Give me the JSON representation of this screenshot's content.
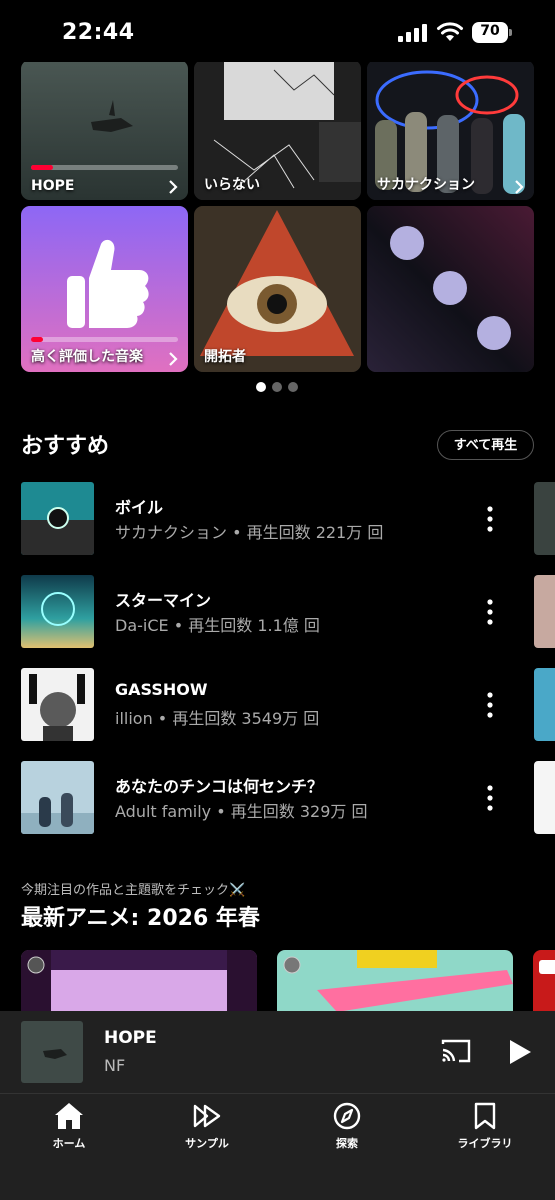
{
  "status_bar": {
    "time": "22:44",
    "battery": "70"
  },
  "tiles": [
    {
      "label": "HOPE",
      "icon": "chevron-right-icon",
      "progress": 0.15
    },
    {
      "label": "いらない",
      "icon": ""
    },
    {
      "label": "サカナクション",
      "icon": "chevron-right-icon"
    },
    {
      "label": "高く評価した音楽",
      "icon": "chevron-right-icon",
      "progress": 0.08
    },
    {
      "label": "開拓者",
      "icon": ""
    },
    {
      "label": "",
      "icon": ""
    }
  ],
  "page_indicator": {
    "pages": 3,
    "active": 1
  },
  "recommendations": {
    "title": "おすすめ",
    "play_all_label": "すべて再生",
    "items": [
      {
        "title": "ボイル",
        "subtitle": "サカナクション • 再生回数 221万 回"
      },
      {
        "title": "スターマイン",
        "subtitle": "Da-iCE • 再生回数 1.1億 回"
      },
      {
        "title": "GASSHOW",
        "subtitle": "illion • 再生回数 3549万 回"
      },
      {
        "title": "あなたのチンコは何センチ？",
        "subtitle": "Adult family • 再生回数 329万 回"
      }
    ]
  },
  "anime_section": {
    "subtitle": "今期注目の作品と主題歌をチェック⚔️",
    "title": "最新アニメ: 2026 年春"
  },
  "mini_player": {
    "title": "HOPE",
    "artist": "NF",
    "cast_icon": "cast-icon",
    "play_icon": "play-icon"
  },
  "bottom_nav": [
    {
      "label": "ホーム",
      "icon": "home-icon"
    },
    {
      "label": "サンプル",
      "icon": "samples-icon"
    },
    {
      "label": "探索",
      "icon": "compass-icon"
    },
    {
      "label": "ライブラリ",
      "icon": "library-icon"
    }
  ],
  "colors": {
    "accent": "#ff0033",
    "background": "#000000",
    "surface": "#212121",
    "secondary_text": "#aaaaaa"
  }
}
